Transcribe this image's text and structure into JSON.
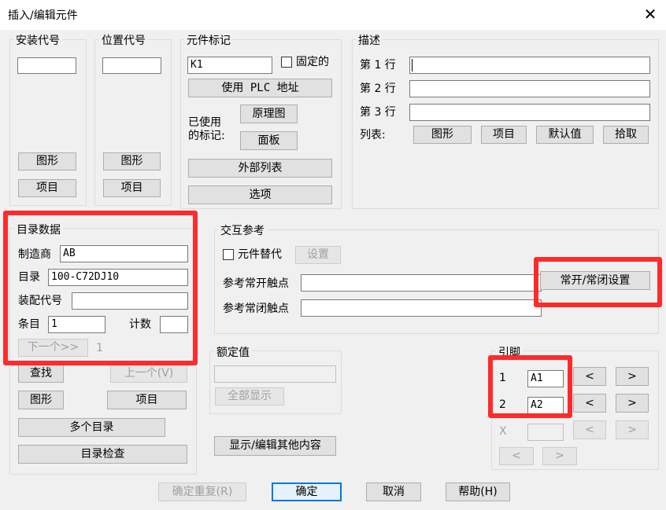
{
  "window": {
    "title": "插入/编辑元件",
    "close_glyph": "✕"
  },
  "install": {
    "label": "安装代号",
    "value": "",
    "graphic": "图形",
    "item": "项目"
  },
  "location": {
    "label": "位置代号",
    "value": "",
    "graphic": "图形",
    "item": "项目"
  },
  "tag": {
    "label": "元件标记",
    "value": "K1",
    "fixed": "固定的",
    "plc": "使用 PLC 地址",
    "used_label_1": "已使用",
    "used_label_2": "的标记:",
    "schematic": "原理图",
    "panel": "面板",
    "external": "外部列表",
    "options": "选项"
  },
  "desc": {
    "label": "描述",
    "line1": "第 1 行",
    "line2": "第 2 行",
    "line3": "第 3 行",
    "list_label": "列表:",
    "graphic": "图形",
    "item": "项目",
    "default": "默认值",
    "pick": "拾取"
  },
  "catalog": {
    "label": "目录数据",
    "mfr_label": "制造商",
    "mfr": "AB",
    "cat_label": "目录",
    "cat": "100-C72DJ10",
    "assy_label": "装配代号",
    "assy": "",
    "entry_label": "条目",
    "entry": "1",
    "count_label": "计数",
    "count": "",
    "next": "下一个>>",
    "next_num": "1",
    "find": "查找",
    "prev": "上一个(V)",
    "graphic": "图形",
    "item": "项目",
    "multi": "多个目录",
    "check": "目录检查"
  },
  "xref": {
    "label": "交互参考",
    "sub": "元件替代",
    "setup": "设置",
    "no_label": "参考常开触点",
    "nc_label": "参考常闭触点",
    "no_nc_setup": "常开/常闭设置"
  },
  "rating": {
    "label": "额定值",
    "show_all": "全部显示"
  },
  "show_edit": "显示/编辑其他内容",
  "pins": {
    "label": "引脚",
    "p1": "1",
    "v1": "A1",
    "p2": "2",
    "v2": "A2",
    "px": "X",
    "lt": "<",
    "gt": ">"
  },
  "footer": {
    "redo": "确定重复(R)",
    "ok": "确定",
    "cancel": "取消",
    "help": "帮助(H)"
  },
  "colors": {
    "highlight": "#ff2a2a",
    "focus": "#0078d7"
  }
}
